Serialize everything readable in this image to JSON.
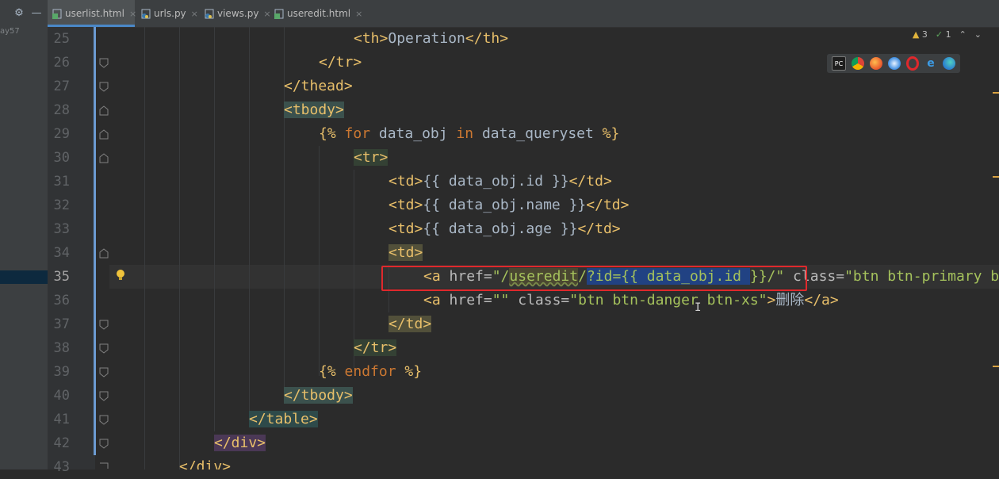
{
  "toolbar": {
    "settings_icon": "gear-icon",
    "minimize_icon": "minus-icon"
  },
  "project_tail": "ay57",
  "tabs": [
    {
      "label": "userlist.html",
      "icon": "html-file-icon",
      "active": true
    },
    {
      "label": "urls.py",
      "icon": "python-file-icon",
      "active": false
    },
    {
      "label": "views.py",
      "icon": "python-file-icon",
      "active": false
    },
    {
      "label": "useredit.html",
      "icon": "html-file-icon",
      "active": false
    }
  ],
  "close_glyph": "×",
  "inspection": {
    "warnings": "3",
    "ok": "1"
  },
  "browser_icons": [
    "pycharm-icon",
    "chrome-icon",
    "firefox-icon",
    "safari-icon",
    "opera-icon",
    "ie-icon",
    "edge-icon"
  ],
  "editor": {
    "current_line": "35",
    "line_numbers": [
      "25",
      "26",
      "27",
      "28",
      "29",
      "30",
      "31",
      "32",
      "33",
      "34",
      "35",
      "36",
      "37",
      "38",
      "39",
      "40",
      "41",
      "42",
      "43"
    ],
    "lines": {
      "l25": {
        "open": "<th>",
        "text": "Operation",
        "close": "</th>"
      },
      "l26": "</tr>",
      "l27": "</thead>",
      "l28": "<tbody>",
      "l29": {
        "a": "{%",
        "b": "for",
        "c": " data_obj ",
        "d": "in",
        "e": " data_queryset ",
        "f": "%}"
      },
      "l30": "<tr>",
      "l31": {
        "open": "<td>",
        "text": "{{ data_obj.id }}",
        "close": "</td>"
      },
      "l32": {
        "open": "<td>",
        "text": "{{ data_obj.name }}",
        "close": "</td>"
      },
      "l33": {
        "open": "<td>",
        "text": "{{ data_obj.age }}",
        "close": "</td>"
      },
      "l34": "<td>",
      "l35": {
        "tag": "<a",
        "attr1": " href=",
        "q1": "\"/",
        "w": "useredit",
        "s1": "/",
        "sel": "?id={{ data_obj.id ",
        "rest": "}}/\"",
        "attr2": " class=",
        "cls": "\"btn btn-primary b"
      },
      "l36": {
        "tag": "<a",
        "attr1": " href=",
        "v1": "\"\"",
        "attr2": " class=",
        "v2": "\"btn btn-danger btn-xs\"",
        "gt": ">",
        "text": "删除",
        "close": "</a>"
      },
      "l37": "</td>",
      "l38": "</tr>",
      "l39": {
        "a": "{%",
        "b": " endfor ",
        "c": "%}"
      },
      "l40": "</tbody>",
      "l41": "</table>",
      "l42": "</div>",
      "l43": "</div>"
    }
  }
}
